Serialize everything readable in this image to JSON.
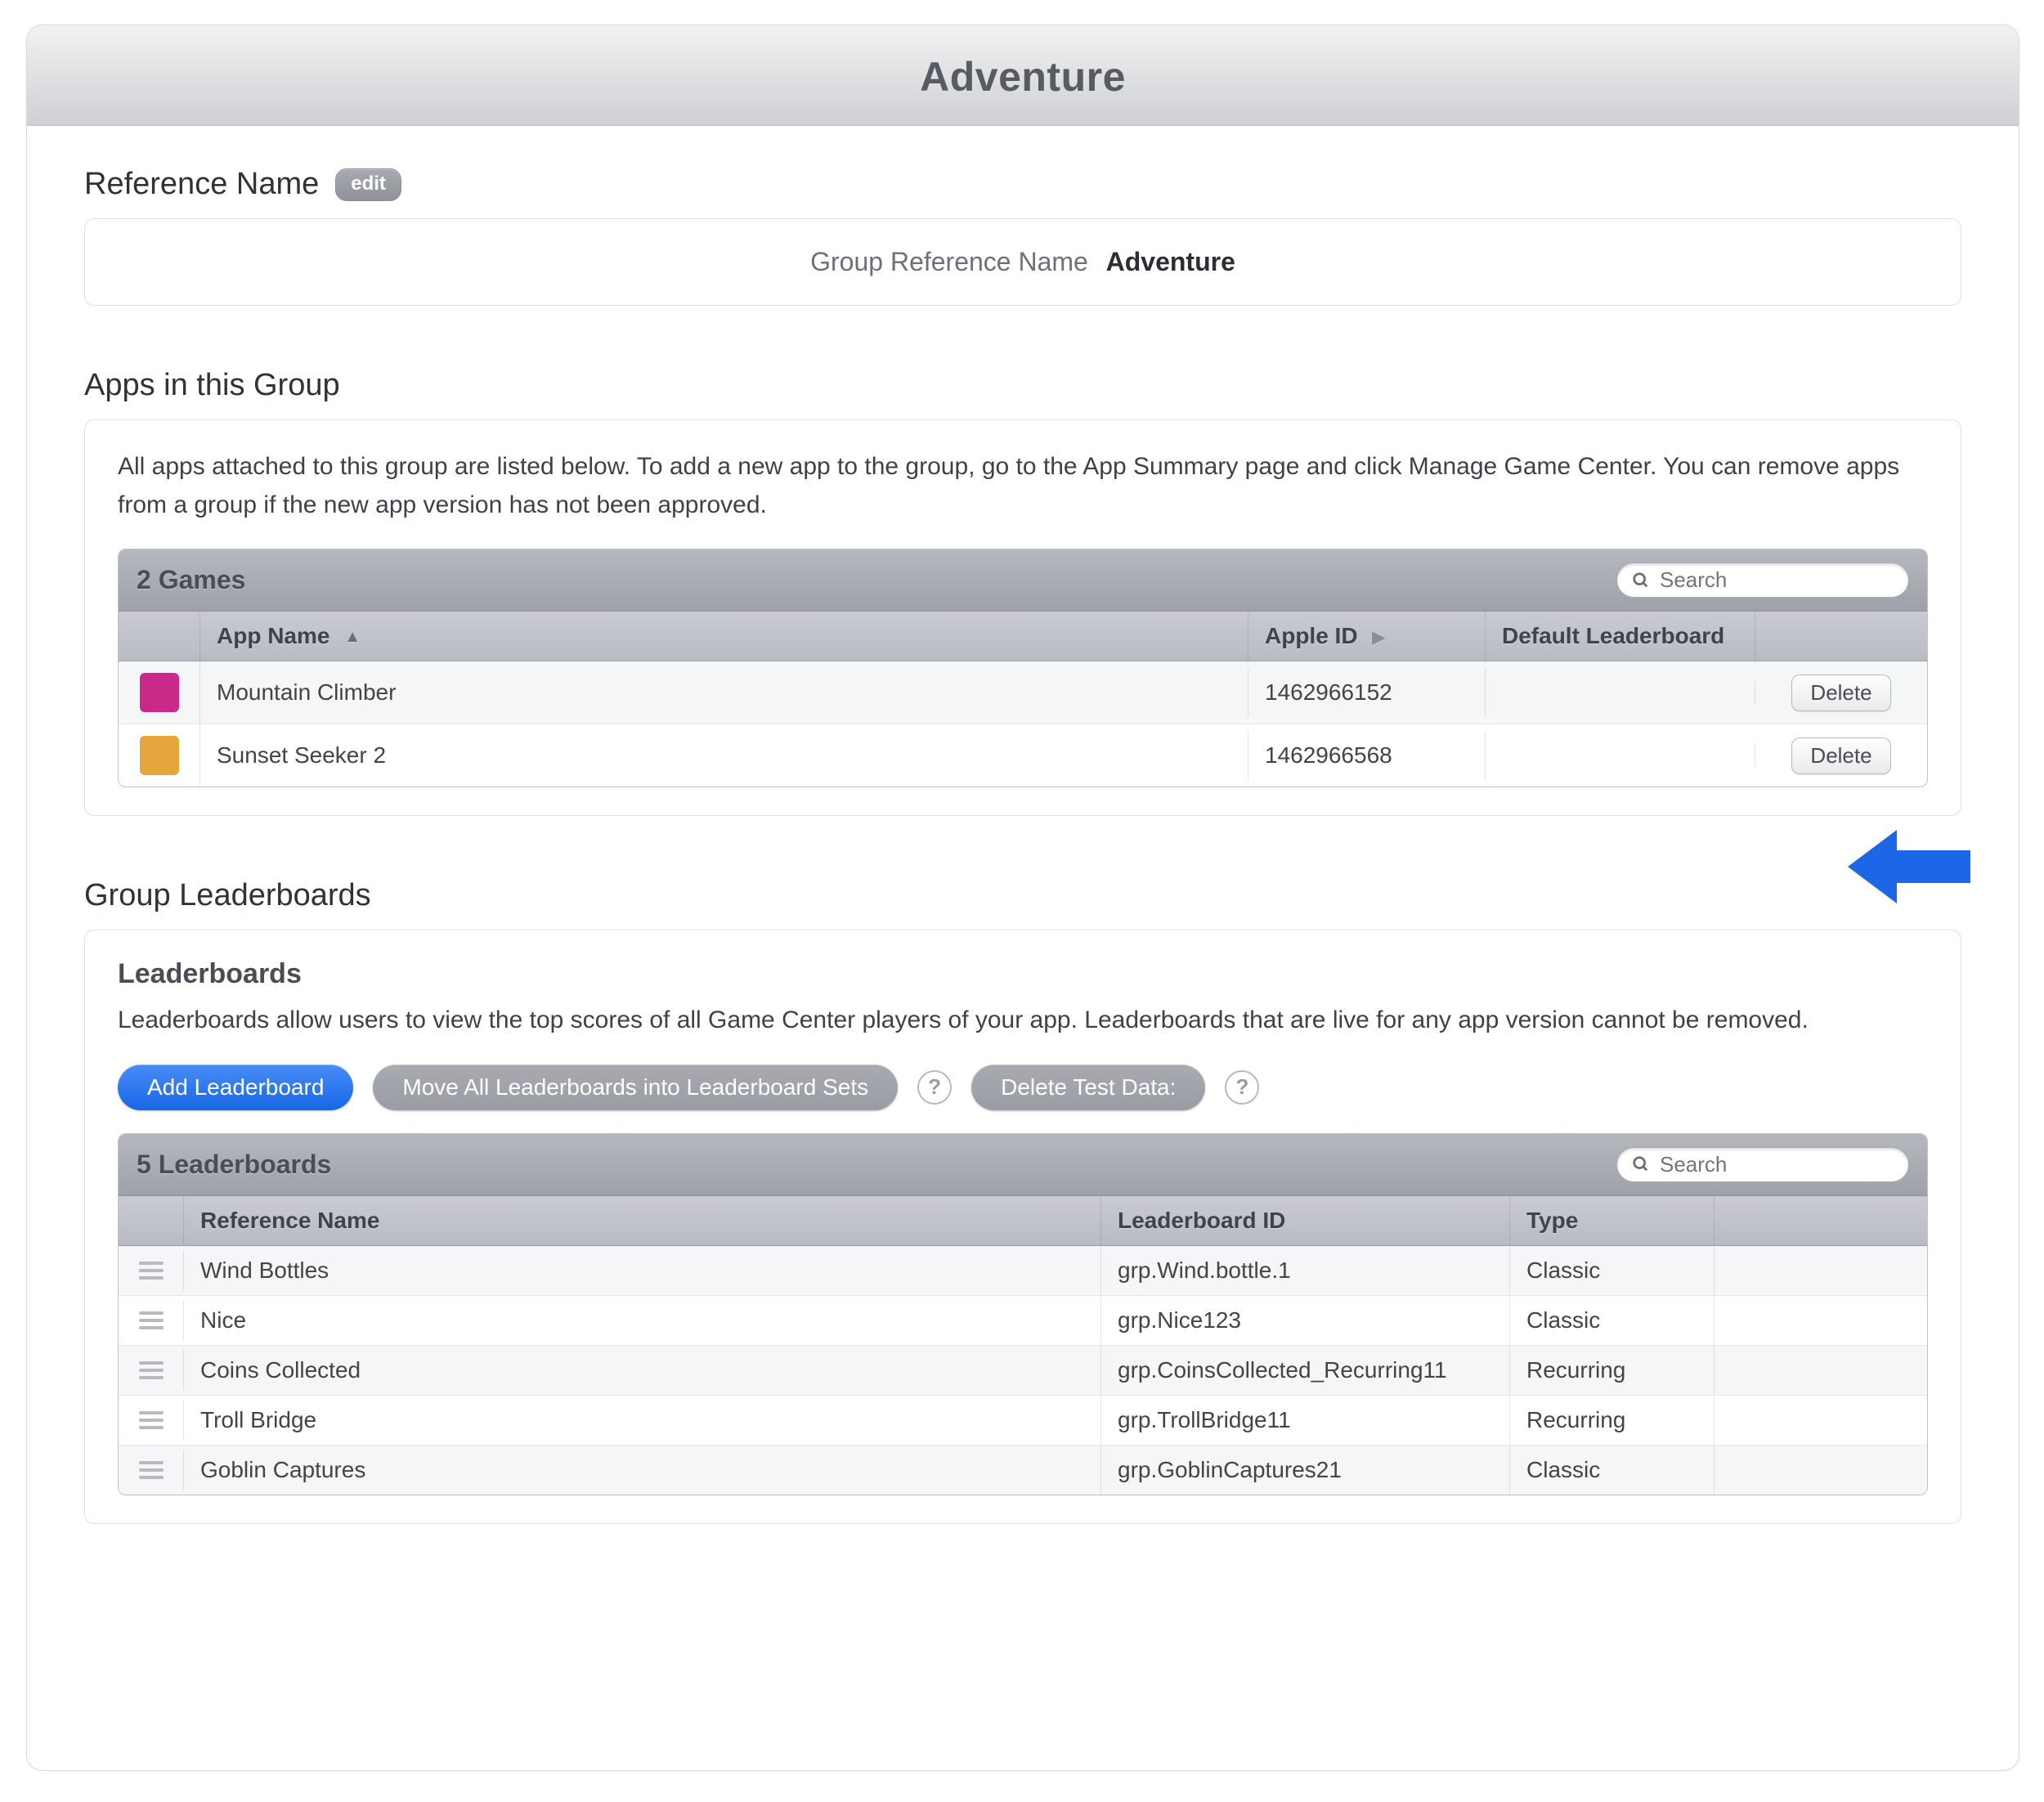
{
  "page_title": "Adventure",
  "reference": {
    "section_label": "Reference Name",
    "edit_label": "edit",
    "field_label": "Group Reference Name",
    "value": "Adventure"
  },
  "apps_section": {
    "title": "Apps in this Group",
    "help": "All apps attached to this group are listed below. To add a new app to the group, go to the App Summary page and click Manage Game Center. You can remove apps from a group if the new app version has not been approved.",
    "count_label": "2 Games",
    "search_placeholder": "Search",
    "columns": {
      "app_name": "App Name",
      "apple_id": "Apple ID",
      "default_lb": "Default Leaderboard"
    },
    "delete_label": "Delete",
    "rows": [
      {
        "name": "Mountain Climber",
        "apple_id": "1462966152",
        "default_lb": "",
        "icon_color": "#c92a8a"
      },
      {
        "name": "Sunset Seeker 2",
        "apple_id": "1462966568",
        "default_lb": "",
        "icon_color": "#e5a63b"
      }
    ]
  },
  "leaderboards_section": {
    "title": "Group Leaderboards",
    "subtitle": "Leaderboards",
    "help": "Leaderboards allow users to view the top scores of all Game Center players of your app. Leaderboards that are live for any app version cannot be removed.",
    "buttons": {
      "add": "Add Leaderboard",
      "move": "Move All Leaderboards into Leaderboard Sets",
      "delete_test": "Delete Test Data:"
    },
    "count_label": "5 Leaderboards",
    "search_placeholder": "Search",
    "columns": {
      "ref_name": "Reference Name",
      "lb_id": "Leaderboard ID",
      "type": "Type"
    },
    "rows": [
      {
        "name": "Wind Bottles",
        "lb_id": "grp.Wind.bottle.1",
        "type": "Classic"
      },
      {
        "name": "Nice",
        "lb_id": "grp.Nice123",
        "type": "Classic"
      },
      {
        "name": "Coins Collected",
        "lb_id": "grp.CoinsCollected_Recurring11",
        "type": "Recurring"
      },
      {
        "name": "Troll Bridge",
        "lb_id": "grp.TrollBridge11",
        "type": "Recurring"
      },
      {
        "name": "Goblin Captures",
        "lb_id": "grp.GoblinCaptures21",
        "type": "Classic"
      }
    ]
  }
}
